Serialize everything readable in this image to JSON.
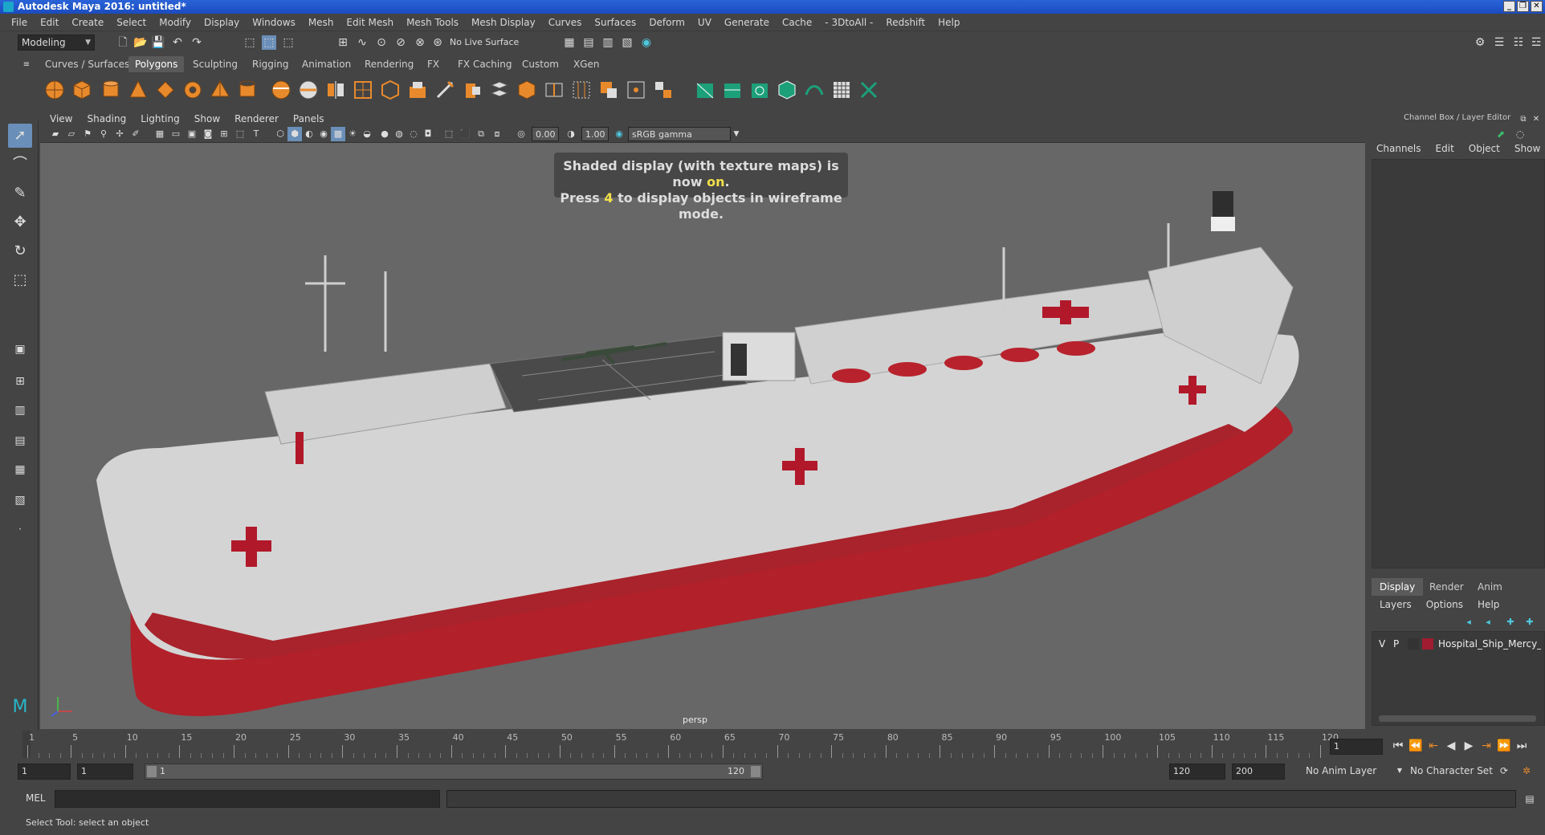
{
  "window": {
    "title": "Autodesk Maya 2016: untitled*"
  },
  "menubar": [
    "File",
    "Edit",
    "Create",
    "Select",
    "Modify",
    "Display",
    "Windows",
    "Mesh",
    "Edit Mesh",
    "Mesh Tools",
    "Mesh Display",
    "Curves",
    "Surfaces",
    "Deform",
    "UV",
    "Generate",
    "Cache",
    "- 3DtoAll -",
    "Redshift",
    "Help"
  ],
  "statusline": {
    "mode": "Modeling",
    "live_surface": "No Live Surface"
  },
  "shelf_tabs": [
    "Curves / Surfaces",
    "Polygons",
    "Sculpting",
    "Rigging",
    "Animation",
    "Rendering",
    "FX",
    "FX Caching",
    "Custom",
    "XGen"
  ],
  "shelf_active": "Polygons",
  "viewport": {
    "menu": [
      "View",
      "Shading",
      "Lighting",
      "Show",
      "Renderer",
      "Panels"
    ],
    "exposure": "0.00",
    "gamma": "1.00",
    "color_space": "sRGB gamma",
    "hud_line1_a": "Shaded display (with texture maps) is now ",
    "hud_line1_b": "on",
    "hud_line1_c": ".",
    "hud_line2_a": "Press ",
    "hud_line2_b": "4",
    "hud_line2_c": " to display objects in wireframe mode.",
    "camera": "persp"
  },
  "channelbox": {
    "header": "Channel Box / Layer Editor",
    "menu": [
      "Channels",
      "Edit",
      "Object",
      "Show"
    ]
  },
  "layers": {
    "tabs": [
      "Display",
      "Render",
      "Anim"
    ],
    "menu": [
      "Layers",
      "Options",
      "Help"
    ],
    "row": {
      "v": "V",
      "p": "P",
      "name": "Hospital_Ship_Mercy_with",
      "color": "#a01c30"
    }
  },
  "timeline": {
    "ticks": [
      "1",
      "5",
      "10",
      "15",
      "20",
      "25",
      "30",
      "35",
      "40",
      "45",
      "50",
      "55",
      "60",
      "65",
      "70",
      "75",
      "80",
      "85",
      "90",
      "95",
      "100",
      "105",
      "110",
      "115",
      "120"
    ],
    "current_frame": "1"
  },
  "range": {
    "start": "1",
    "playback_start": "1",
    "slider_start": "1",
    "slider_end": "120",
    "playback_end": "120",
    "end": "200",
    "anim_layer": "No Anim Layer",
    "character_set": "No Character Set"
  },
  "cmdline": {
    "label": "MEL"
  },
  "helpline": {
    "text": "Select Tool: select an object"
  }
}
